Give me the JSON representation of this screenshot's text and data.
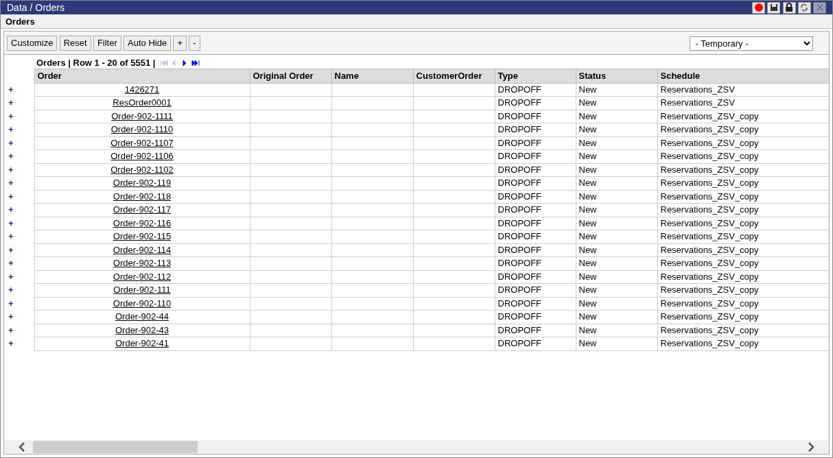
{
  "window": {
    "title": "Data / Orders",
    "buttons": [
      {
        "kind": "record"
      },
      {
        "kind": "save"
      },
      {
        "kind": "lock"
      },
      {
        "kind": "refresh"
      },
      {
        "kind": "close",
        "disabled": true
      }
    ]
  },
  "subtitle": "Orders",
  "toolbar": {
    "buttons": [
      "Customize",
      "Reset",
      "Filter",
      "Auto Hide",
      "+",
      "-"
    ],
    "view_select": {
      "value": "- Temporary -"
    }
  },
  "pager": {
    "text": "Orders | Row 1 - 20 of 5551 |",
    "buttons": [
      {
        "kind": "first",
        "disabled": true
      },
      {
        "kind": "prev",
        "disabled": true
      },
      {
        "kind": "next",
        "disabled": false
      },
      {
        "kind": "last",
        "disabled": false
      }
    ]
  },
  "table": {
    "columns": [
      "Order",
      "Original Order",
      "Name",
      "CustomerOrder",
      "Type",
      "Status",
      "Schedule"
    ],
    "rows": [
      {
        "expander": "+",
        "order": "1426271",
        "type": "DROPOFF",
        "status": "New",
        "schedule": "Reservations_ZSV"
      },
      {
        "expander": "+",
        "order": "ResOrder0001",
        "type": "DROPOFF",
        "status": "New",
        "schedule": "Reservations_ZSV"
      },
      {
        "expander": "+",
        "order": "Order-902-1111",
        "type": "DROPOFF",
        "status": "New",
        "schedule": "Reservations_ZSV_copy"
      },
      {
        "expander": "+",
        "order": "Order-902-1110",
        "type": "DROPOFF",
        "status": "New",
        "schedule": "Reservations_ZSV_copy"
      },
      {
        "expander": "+",
        "order": "Order-902-1107",
        "type": "DROPOFF",
        "status": "New",
        "schedule": "Reservations_ZSV_copy"
      },
      {
        "expander": "+",
        "order": "Order-902-1106",
        "type": "DROPOFF",
        "status": "New",
        "schedule": "Reservations_ZSV_copy"
      },
      {
        "expander": "+",
        "order": "Order-902-1102",
        "type": "DROPOFF",
        "status": "New",
        "schedule": "Reservations_ZSV_copy"
      },
      {
        "expander": "+",
        "order": "Order-902-119",
        "type": "DROPOFF",
        "status": "New",
        "schedule": "Reservations_ZSV_copy"
      },
      {
        "expander": "+",
        "order": "Order-902-118",
        "type": "DROPOFF",
        "status": "New",
        "schedule": "Reservations_ZSV_copy"
      },
      {
        "expander": "+",
        "order": "Order-902-117",
        "type": "DROPOFF",
        "status": "New",
        "schedule": "Reservations_ZSV_copy"
      },
      {
        "expander": "+",
        "order": "Order-902-116",
        "type": "DROPOFF",
        "status": "New",
        "schedule": "Reservations_ZSV_copy"
      },
      {
        "expander": "+",
        "order": "Order-902-115",
        "type": "DROPOFF",
        "status": "New",
        "schedule": "Reservations_ZSV_copy"
      },
      {
        "expander": "+",
        "order": "Order-902-114",
        "type": "DROPOFF",
        "status": "New",
        "schedule": "Reservations_ZSV_copy"
      },
      {
        "expander": "+",
        "order": "Order-902-113",
        "type": "DROPOFF",
        "status": "New",
        "schedule": "Reservations_ZSV_copy"
      },
      {
        "expander": "+",
        "order": "Order-902-112",
        "type": "DROPOFF",
        "status": "New",
        "schedule": "Reservations_ZSV_copy"
      },
      {
        "expander": "+",
        "order": "Order-902-111",
        "type": "DROPOFF",
        "status": "New",
        "schedule": "Reservations_ZSV_copy"
      },
      {
        "expander": "+",
        "order": "Order-902-110",
        "type": "DROPOFF",
        "status": "New",
        "schedule": "Reservations_ZSV_copy"
      },
      {
        "expander": "+",
        "order": "Order-902-44",
        "type": "DROPOFF",
        "status": "New",
        "schedule": "Reservations_ZSV_copy"
      },
      {
        "expander": "+",
        "order": "Order-902-43",
        "type": "DROPOFF",
        "status": "New",
        "schedule": "Reservations_ZSV_copy"
      },
      {
        "expander": "+",
        "order": "Order-902-41",
        "type": "DROPOFF",
        "status": "New",
        "schedule": "Reservations_ZSV_copy"
      }
    ]
  }
}
